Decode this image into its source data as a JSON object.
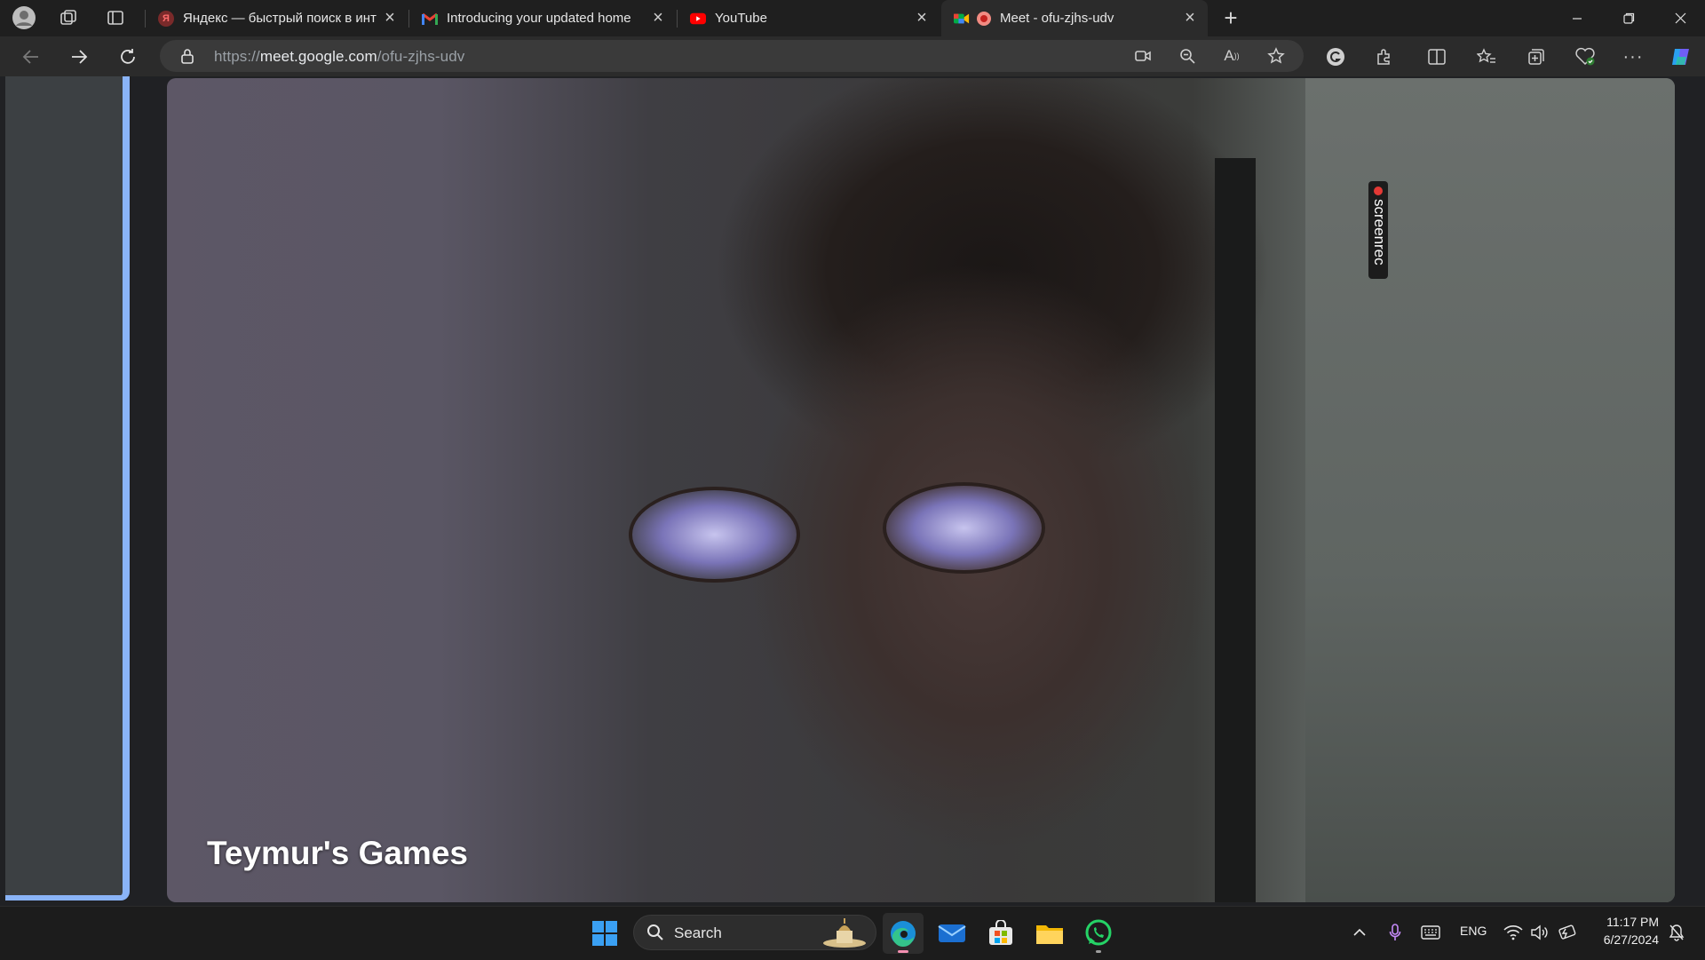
{
  "browser": {
    "tabs": [
      {
        "title": "Яндекс — быстрый поиск в инт",
        "favicon": "yandex-icon",
        "active": false
      },
      {
        "title": "Introducing your updated home",
        "favicon": "gmail-icon",
        "active": false
      },
      {
        "title": "YouTube",
        "favicon": "youtube-icon",
        "active": false
      },
      {
        "title": "Meet - ofu-zjhs-udv",
        "favicon": "google-meet-icon",
        "active": true
      }
    ],
    "address_bar": {
      "scheme": "https://",
      "host": "meet.google.com",
      "path": "/ofu-zjhs-udv"
    }
  },
  "meet": {
    "participant_name": "Teymur's Games",
    "recording_badge": "screenrec"
  },
  "taskbar": {
    "search_label": "Search",
    "apps": [
      "windows-start-icon",
      "edge-icon",
      "mail-icon",
      "store-icon",
      "file-explorer-icon",
      "whatsapp-icon"
    ],
    "tray": {
      "language": "ENG",
      "time": "11:17 PM",
      "date": "6/27/2024"
    }
  },
  "colors": {
    "accent_blue": "#8ab4f8",
    "recording_red": "#e53935",
    "youtube_red": "#ff0000"
  }
}
